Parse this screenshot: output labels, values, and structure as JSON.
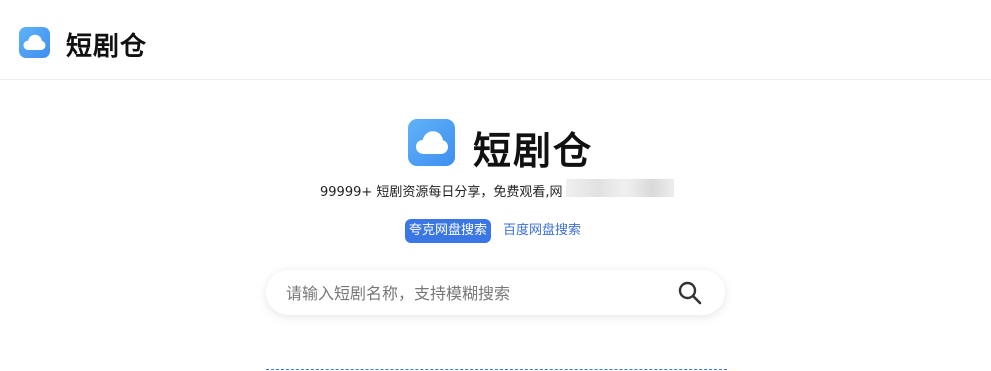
{
  "header": {
    "site_name": "短剧仓"
  },
  "hero": {
    "title": "短剧仓",
    "tagline": "99999+ 短剧资源每日分享，免费观看,网"
  },
  "tabs": [
    {
      "label": "夸克网盘搜索",
      "active": true
    },
    {
      "label": "百度网盘搜索",
      "active": false
    }
  ],
  "search": {
    "placeholder": "请输入短剧名称，支持模糊搜索",
    "value": ""
  },
  "colors": {
    "accent": "#3b77e4",
    "logo_gradient_start": "#5fb3f7",
    "logo_gradient_end": "#3f8ef0"
  },
  "icons": {
    "logo": "cloud-icon",
    "search": "search-icon"
  }
}
